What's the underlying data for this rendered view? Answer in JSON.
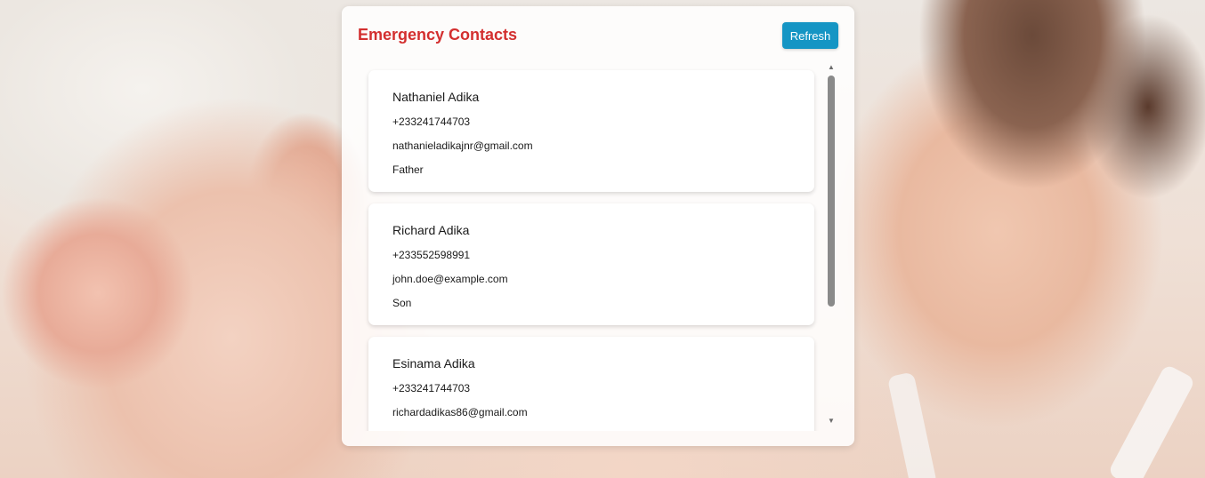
{
  "panel": {
    "title": "Emergency Contacts",
    "refresh_label": "Refresh"
  },
  "contacts": [
    {
      "name": "Nathaniel Adika",
      "phone": "+233241744703",
      "email": "nathanieladikajnr@gmail.com",
      "relation": "Father"
    },
    {
      "name": "Richard Adika",
      "phone": "+233552598991",
      "email": "john.doe@example.com",
      "relation": "Son"
    },
    {
      "name": "Esinama Adika",
      "phone": "+233241744703",
      "email": "richardadikas86@gmail.com",
      "relation": ""
    }
  ],
  "scrollbar": {
    "up_icon": "triangle-up-icon",
    "down_icon": "triangle-down-icon"
  },
  "colors": {
    "title": "#d32f2f",
    "button": "#1595c4",
    "card": "#ffffff"
  }
}
